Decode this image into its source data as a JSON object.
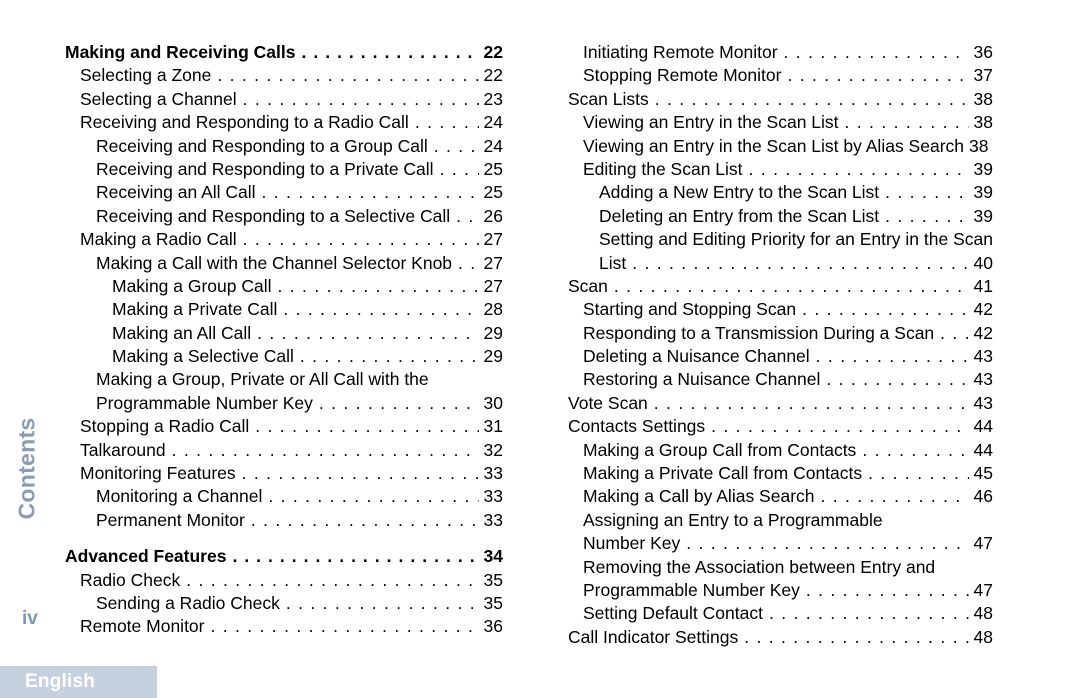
{
  "page": {
    "side_tab_label": "Contents",
    "folio": "iv",
    "language_banner": "English"
  },
  "toc": {
    "left_column": [
      {
        "title": "Making and Receiving Calls",
        "page": "22",
        "level": 0,
        "bold": true,
        "leader": true,
        "gap_before": false
      },
      {
        "title": "Selecting a Zone",
        "page": "22",
        "level": 1,
        "bold": false,
        "leader": true,
        "gap_before": false
      },
      {
        "title": "Selecting a Channel",
        "page": "23",
        "level": 1,
        "bold": false,
        "leader": true,
        "gap_before": false
      },
      {
        "title": "Receiving and Responding to a Radio Call",
        "page": "24",
        "level": 1,
        "bold": false,
        "leader": true,
        "gap_before": false
      },
      {
        "title": "Receiving and Responding to a Group Call",
        "page": "24",
        "level": 2,
        "bold": false,
        "leader": true,
        "gap_before": false
      },
      {
        "title": "Receiving and Responding to a Private Call",
        "page": "25",
        "level": 2,
        "bold": false,
        "leader": true,
        "gap_before": false
      },
      {
        "title": "Receiving an All Call",
        "page": "25",
        "level": 2,
        "bold": false,
        "leader": true,
        "gap_before": false
      },
      {
        "title": "Receiving and Responding to a Selective Call",
        "page": "26",
        "level": 2,
        "bold": false,
        "leader": true,
        "gap_before": false
      },
      {
        "title": "Making a Radio Call",
        "page": "27",
        "level": 1,
        "bold": false,
        "leader": true,
        "gap_before": false
      },
      {
        "title": "Making a Call with the Channel Selector Knob",
        "page": "27",
        "level": 2,
        "bold": false,
        "leader": true,
        "gap_before": false
      },
      {
        "title": "Making a Group Call",
        "page": "27",
        "level": 3,
        "bold": false,
        "leader": true,
        "gap_before": false
      },
      {
        "title": "Making a Private Call",
        "page": "28",
        "level": 3,
        "bold": false,
        "leader": true,
        "gap_before": false
      },
      {
        "title": "Making an All Call",
        "page": "29",
        "level": 3,
        "bold": false,
        "leader": true,
        "gap_before": false
      },
      {
        "title": "Making a Selective Call",
        "page": "29",
        "level": 3,
        "bold": false,
        "leader": true,
        "gap_before": false
      },
      {
        "title": "Making a Group, Private or All Call with the",
        "page": "",
        "level": 2,
        "bold": false,
        "leader": false,
        "gap_before": false
      },
      {
        "title": "Programmable Number Key",
        "page": "30",
        "level": 2,
        "bold": false,
        "leader": true,
        "gap_before": false
      },
      {
        "title": "Stopping a Radio Call",
        "page": "31",
        "level": 1,
        "bold": false,
        "leader": true,
        "gap_before": false
      },
      {
        "title": "Talkaround",
        "page": "32",
        "level": 1,
        "bold": false,
        "leader": true,
        "gap_before": false
      },
      {
        "title": "Monitoring Features",
        "page": "33",
        "level": 1,
        "bold": false,
        "leader": true,
        "gap_before": false
      },
      {
        "title": "Monitoring a Channel",
        "page": "33",
        "level": 2,
        "bold": false,
        "leader": true,
        "gap_before": false
      },
      {
        "title": "Permanent Monitor",
        "page": "33",
        "level": 2,
        "bold": false,
        "leader": true,
        "gap_before": false
      },
      {
        "title": "Advanced Features",
        "page": "34",
        "level": 0,
        "bold": true,
        "leader": true,
        "gap_before": true
      },
      {
        "title": "Radio Check",
        "page": "35",
        "level": 1,
        "bold": false,
        "leader": true,
        "gap_before": false
      },
      {
        "title": "Sending a Radio Check",
        "page": "35",
        "level": 2,
        "bold": false,
        "leader": true,
        "gap_before": false
      },
      {
        "title": "Remote Monitor",
        "page": "36",
        "level": 1,
        "bold": false,
        "leader": true,
        "gap_before": false
      }
    ],
    "right_column": [
      {
        "title": "Initiating Remote Monitor",
        "page": "36",
        "level": 1,
        "bold": false,
        "leader": true,
        "gap_before": false
      },
      {
        "title": "Stopping Remote Monitor",
        "page": "37",
        "level": 1,
        "bold": false,
        "leader": true,
        "gap_before": false
      },
      {
        "title": "Scan Lists",
        "page": "38",
        "level": 0,
        "bold": false,
        "leader": true,
        "gap_before": false
      },
      {
        "title": "Viewing an Entry in the Scan List",
        "page": "38",
        "level": 1,
        "bold": false,
        "leader": true,
        "gap_before": false
      },
      {
        "title": "Viewing an Entry in the Scan List by Alias Search",
        "page": "38",
        "level": 1,
        "bold": false,
        "leader": false,
        "tight": true,
        "gap_before": false
      },
      {
        "title": "Editing the Scan List",
        "page": "39",
        "level": 1,
        "bold": false,
        "leader": true,
        "gap_before": false
      },
      {
        "title": "Adding a New Entry to the Scan List",
        "page": "39",
        "level": 2,
        "bold": false,
        "leader": true,
        "gap_before": false
      },
      {
        "title": "Deleting an Entry from the Scan List",
        "page": "39",
        "level": 2,
        "bold": false,
        "leader": true,
        "gap_before": false
      },
      {
        "title": "Setting and Editing Priority for an Entry in the Scan",
        "page": "",
        "level": 2,
        "bold": false,
        "leader": false,
        "gap_before": false
      },
      {
        "title": "List",
        "page": "40",
        "level": 2,
        "bold": false,
        "leader": true,
        "gap_before": false
      },
      {
        "title": "Scan",
        "page": "41",
        "level": 0,
        "bold": false,
        "leader": true,
        "gap_before": false
      },
      {
        "title": "Starting and Stopping Scan",
        "page": "42",
        "level": 1,
        "bold": false,
        "leader": true,
        "gap_before": false
      },
      {
        "title": "Responding to a Transmission During a Scan",
        "page": "42",
        "level": 1,
        "bold": false,
        "leader": true,
        "gap_before": false
      },
      {
        "title": "Deleting a Nuisance Channel",
        "page": "43",
        "level": 1,
        "bold": false,
        "leader": true,
        "gap_before": false
      },
      {
        "title": "Restoring a Nuisance Channel",
        "page": "43",
        "level": 1,
        "bold": false,
        "leader": true,
        "gap_before": false
      },
      {
        "title": "Vote Scan",
        "page": "43",
        "level": 0,
        "bold": false,
        "leader": true,
        "gap_before": false
      },
      {
        "title": "Contacts Settings",
        "page": "44",
        "level": 0,
        "bold": false,
        "leader": true,
        "gap_before": false
      },
      {
        "title": "Making a Group Call from Contacts",
        "page": "44",
        "level": 1,
        "bold": false,
        "leader": true,
        "gap_before": false
      },
      {
        "title": "Making a Private Call from Contacts",
        "page": "45",
        "level": 1,
        "bold": false,
        "leader": true,
        "gap_before": false
      },
      {
        "title": "Making a Call by Alias Search",
        "page": "46",
        "level": 1,
        "bold": false,
        "leader": true,
        "gap_before": false
      },
      {
        "title": "Assigning an Entry to a Programmable",
        "page": "",
        "level": 1,
        "bold": false,
        "leader": false,
        "gap_before": false
      },
      {
        "title": "Number Key",
        "page": "47",
        "level": 1,
        "bold": false,
        "leader": true,
        "gap_before": false
      },
      {
        "title": "Removing the Association between Entry and",
        "page": "",
        "level": 1,
        "bold": false,
        "leader": false,
        "gap_before": false
      },
      {
        "title": "Programmable Number Key",
        "page": "47",
        "level": 1,
        "bold": false,
        "leader": true,
        "gap_before": false
      },
      {
        "title": "Setting Default Contact",
        "page": "48",
        "level": 1,
        "bold": false,
        "leader": true,
        "gap_before": false
      },
      {
        "title": "Call Indicator Settings",
        "page": "48",
        "level": 0,
        "bold": false,
        "leader": true,
        "gap_before": false
      }
    ]
  },
  "colors": {
    "side_tab_text": "#8a9cb4",
    "banner_background": "#c6d1e0",
    "banner_text": "#ffffff",
    "body_text": "#000000"
  }
}
